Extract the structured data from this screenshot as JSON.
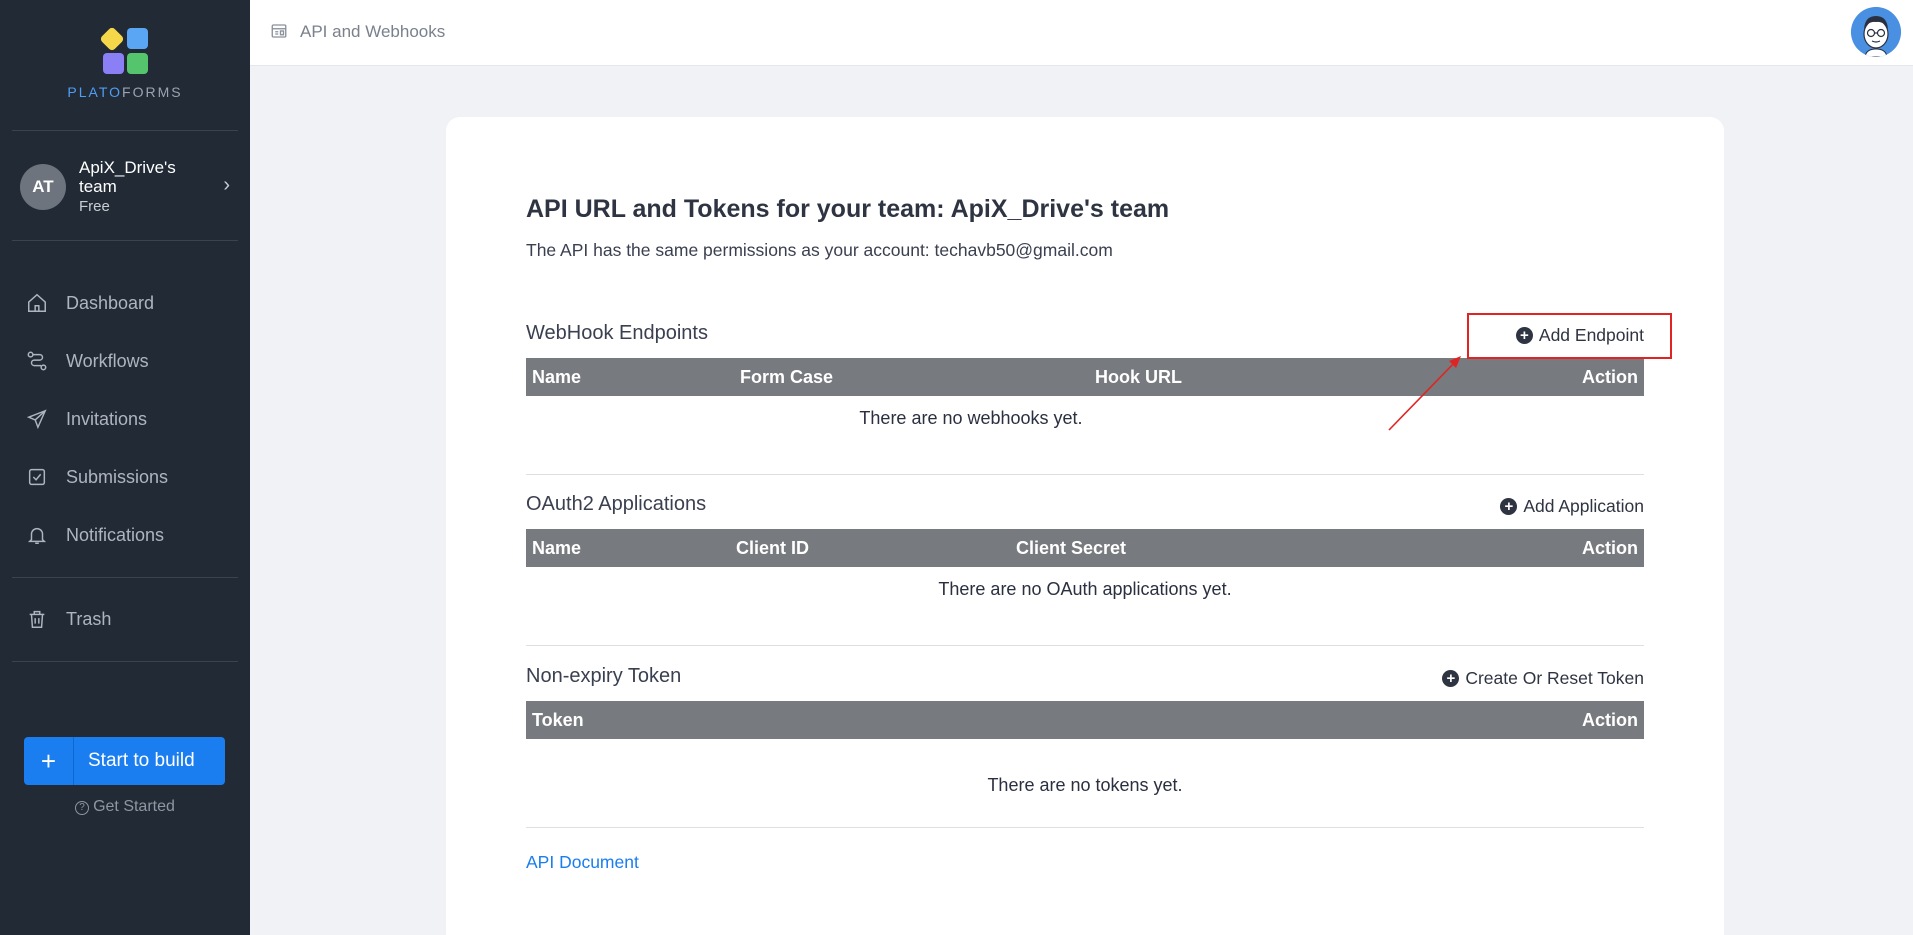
{
  "brand": {
    "name_part1": "PLATO",
    "name_part2": "FORMS"
  },
  "team": {
    "initials": "AT",
    "name": "ApiX_Drive's team",
    "plan": "Free"
  },
  "nav": [
    {
      "label": "Dashboard",
      "icon": "home-icon"
    },
    {
      "label": "Workflows",
      "icon": "workflow-icon"
    },
    {
      "label": "Invitations",
      "icon": "send-icon"
    },
    {
      "label": "Submissions",
      "icon": "inbox-icon"
    },
    {
      "label": "Notifications",
      "icon": "bell-icon"
    },
    {
      "label": "Trash",
      "icon": "trash-icon"
    }
  ],
  "build": {
    "label": "Start to build",
    "plus": "+"
  },
  "get_started": "Get Started",
  "topbar": {
    "title": "API and Webhooks"
  },
  "page": {
    "heading": "API URL and Tokens for your team: ApiX_Drive's team",
    "subheading": "The API has the same permissions as your account: techavb50@gmail.com"
  },
  "webhooks": {
    "title": "WebHook Endpoints",
    "action": "Add Endpoint",
    "columns": [
      "Name",
      "Form Case",
      "Hook URL",
      "Action"
    ],
    "empty": "There are no webhooks yet."
  },
  "oauth": {
    "title": "OAuth2 Applications",
    "action": "Add Application",
    "columns": [
      "Name",
      "Client ID",
      "Client Secret",
      "Action"
    ],
    "empty": "There are no OAuth applications yet."
  },
  "token": {
    "title": "Non-expiry Token",
    "action": "Create Or Reset Token",
    "columns": [
      "Token",
      "Action"
    ],
    "empty": "There are no tokens yet."
  },
  "api_document": "API Document",
  "colors": {
    "sidebar": "#222a35",
    "primary": "#1a7df0",
    "table_header": "#777a7e",
    "highlight": "#e02424"
  }
}
